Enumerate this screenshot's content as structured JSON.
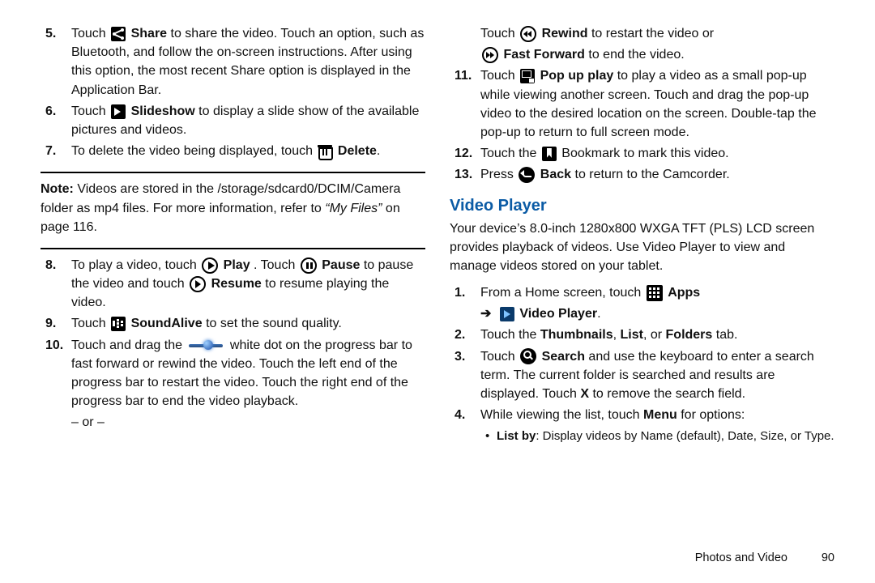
{
  "left": {
    "i5": {
      "n": "5.",
      "t1": "Touch ",
      "icon": "share",
      "b1": "Share",
      "t2": " to share the video. Touch an option, such as Bluetooth, and follow the on-screen instructions. After using this option, the most recent Share option is displayed in the Application Bar."
    },
    "i6": {
      "n": "6.",
      "t1": "Touch ",
      "icon": "slide",
      "b1": "Slideshow",
      "t2": " to display a slide show of the available pictures and videos."
    },
    "i7": {
      "n": "7.",
      "t1": "To delete the video being displayed, touch ",
      "icon": "trash",
      "b1": "Delete",
      "t2": "."
    },
    "note": {
      "lead": "Note:",
      "text1": " Videos are stored in the /storage/sdcard0/DCIM/Camera folder as mp4 files. For more information, refer to ",
      "ital": "“My Files”",
      "text2": " on page 116."
    },
    "i8": {
      "n": "8.",
      "t1": "To play a video, touch ",
      "b1": "Play",
      "t2": ". Touch ",
      "b2": "Pause",
      "t3": " to pause the video and touch ",
      "b3": "Resume",
      "t4": " to resume playing the video."
    },
    "i9": {
      "n": "9.",
      "t1": "Touch ",
      "b1": "SoundAlive",
      "t2": " to set the sound quality."
    },
    "i10": {
      "n": "10.",
      "t1": "Touch and drag the ",
      "t2": " white dot on the progress bar to fast forward or rewind the video. Touch the left end of the progress bar to restart the video. Touch the right end of the progress bar to end the video playback."
    },
    "or": "– or –"
  },
  "right": {
    "top1": {
      "t1": "Touch ",
      "b1": "Rewind",
      "t2": " to restart the video or"
    },
    "top2": {
      "b1": "Fast Forward",
      "t2": " to end the video."
    },
    "i11": {
      "n": "11.",
      "t1": "Touch ",
      "b1": "Pop up play",
      "t2": " to play a video as a small pop-up while viewing another screen. Touch and drag the pop-up video to the desired location on the screen. Double-tap the pop-up to return to full screen mode."
    },
    "i12": {
      "n": "12.",
      "t1": "Touch the ",
      "t2": " Bookmark to mark this video."
    },
    "i13": {
      "n": "13.",
      "t1": "Press ",
      "b1": "Back",
      "t2": " to return to the Camcorder."
    },
    "section": "Video Player",
    "intro": "Your device’s 8.0-inch 1280x800 WXGA TFT (PLS) LCD screen provides playback of videos. Use Video Player to view and manage videos stored on your tablet.",
    "v1": {
      "n": "1.",
      "t1": "From a Home screen, touch ",
      "b1": "Apps"
    },
    "v1b": {
      "arrow": "➔",
      "b1": "Video Player",
      "t2": "."
    },
    "v2": {
      "n": "2.",
      "t1": "Touch the ",
      "b1": "Thumbnails",
      "c1": ", ",
      "b2": "List",
      "c2": ", or ",
      "b3": "Folders",
      "t2": " tab."
    },
    "v3": {
      "n": "3.",
      "t1": "Touch ",
      "b1": "Search",
      "t2": " and use the keyboard to enter a search term. The current folder is searched and results are displayed. Touch ",
      "b2": "X",
      "t3": " to remove the search field."
    },
    "v4": {
      "n": "4.",
      "t1": "While viewing the list, touch ",
      "b1": "Menu",
      "t2": " for options:"
    },
    "v4a": {
      "bul": "•",
      "b1": "List by",
      "t1": ": Display videos by Name (default), Date, Size, or Type."
    }
  },
  "footer": {
    "section": "Photos and Video",
    "page": "90"
  }
}
